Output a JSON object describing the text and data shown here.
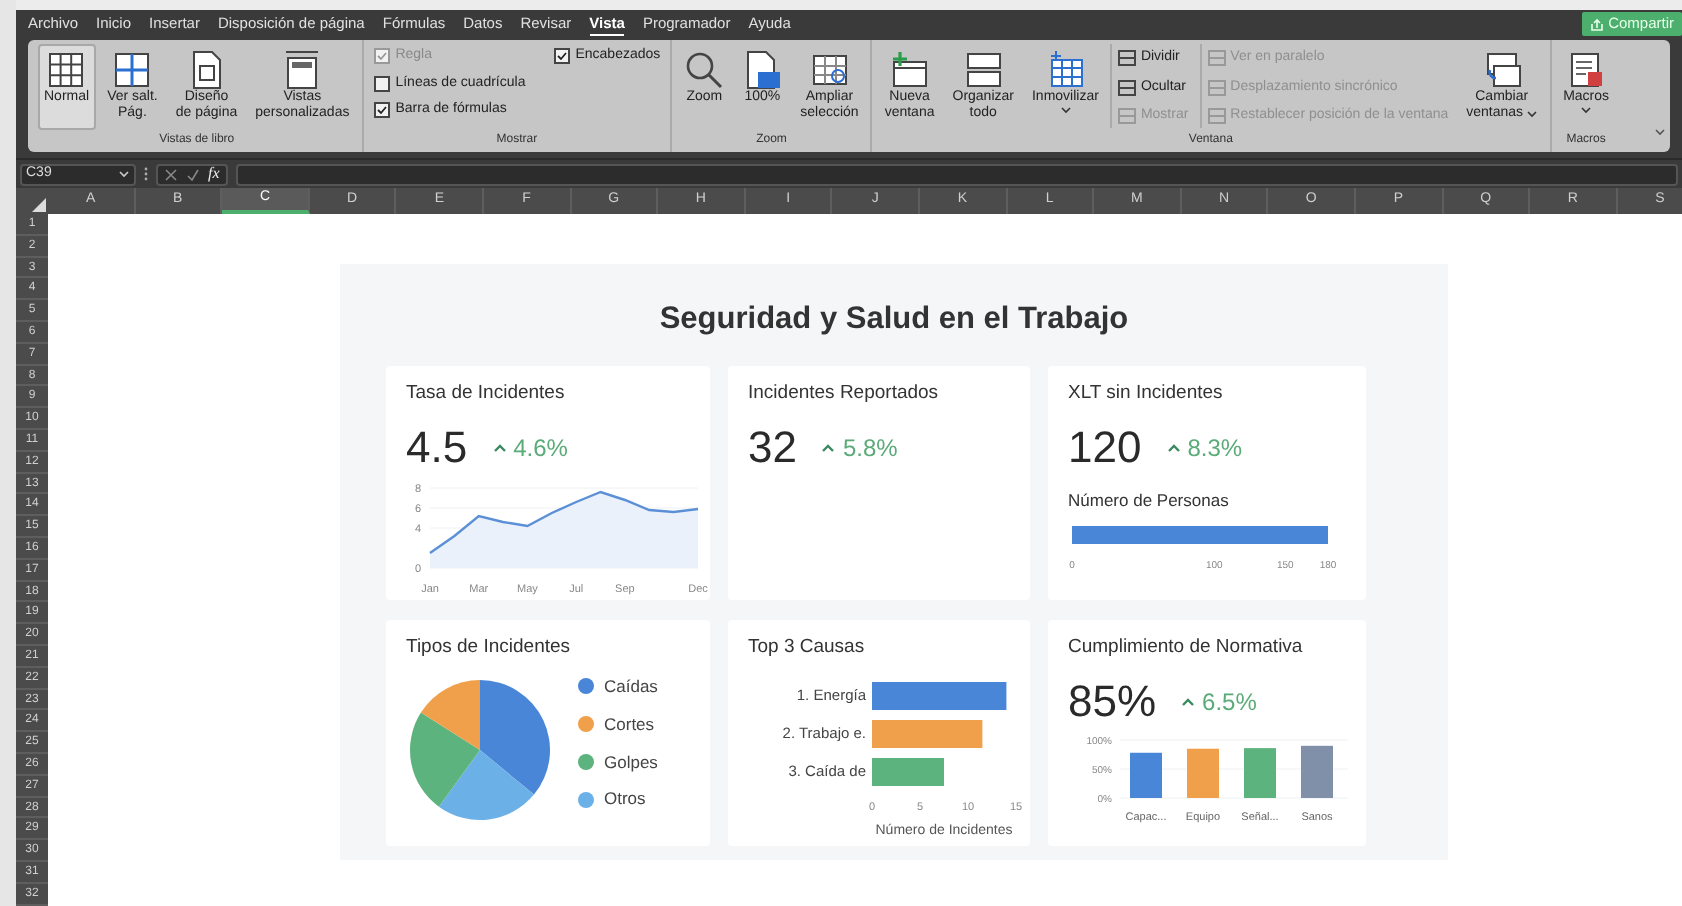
{
  "menu": [
    {
      "label": "Archivo",
      "selected": false
    },
    {
      "label": "Inicio",
      "selected": false
    },
    {
      "label": "Insertar",
      "selected": false
    },
    {
      "label": "Disposición de página",
      "selected": false
    },
    {
      "label": "Fórmulas",
      "selected": false
    },
    {
      "label": "Datos",
      "selected": false
    },
    {
      "label": "Revisar",
      "selected": false
    },
    {
      "label": "Vista",
      "selected": true
    },
    {
      "label": "Programador",
      "selected": false
    },
    {
      "label": "Ayuda",
      "selected": false
    }
  ],
  "share_button": "Compartir",
  "ribbon": [
    {
      "label": "Vistas de libro",
      "items": [
        {
          "kind": "large",
          "lines": [
            "Normal"
          ],
          "selected": true
        },
        {
          "kind": "large",
          "lines": [
            "Ver salt.",
            "Pág."
          ],
          "selected": false
        },
        {
          "kind": "large",
          "lines": [
            "Diseño",
            "de página"
          ],
          "selected": false
        },
        {
          "kind": "large",
          "lines": [
            "Vistas",
            "personalizadas"
          ],
          "selected": false
        }
      ]
    },
    {
      "label": "Mostrar",
      "items": [
        {
          "kind": "check",
          "label": "Regla",
          "checked": true,
          "disabled": true
        },
        {
          "kind": "check",
          "label": "Líneas de cuadrícula",
          "checked": false,
          "disabled": false
        },
        {
          "kind": "check",
          "label": "Barra de fórmulas",
          "checked": true,
          "disabled": false
        },
        {
          "kind": "check",
          "label": "Encabezados",
          "checked": true,
          "disabled": false
        }
      ]
    },
    {
      "label": "Zoom",
      "items": [
        {
          "kind": "large",
          "lines": [
            "Zoom"
          ]
        },
        {
          "kind": "large",
          "lines": [
            "100%"
          ]
        },
        {
          "kind": "large",
          "lines": [
            "Ampliar",
            "selección"
          ]
        }
      ]
    },
    {
      "label": "Ventana",
      "items": [
        {
          "kind": "large",
          "lines": [
            "Nueva",
            "ventana"
          ]
        },
        {
          "kind": "large",
          "lines": [
            "Organizar",
            "todo"
          ]
        },
        {
          "kind": "large",
          "lines": [
            "Inmovilizar"
          ],
          "dropdown": true
        },
        {
          "kind": "small",
          "label": "Dividir",
          "disabled": false
        },
        {
          "kind": "small",
          "label": "Ocultar",
          "disabled": false
        },
        {
          "kind": "small",
          "label": "Mostrar",
          "disabled": true
        },
        {
          "kind": "small",
          "label": "Ver en paralelo",
          "disabled": true
        },
        {
          "kind": "small",
          "label": "Desplazamiento sincrónico",
          "disabled": true
        },
        {
          "kind": "small",
          "label": "Restablecer posición de la ventana",
          "disabled": true
        },
        {
          "kind": "large",
          "lines": [
            "Cambiar",
            "ventanas"
          ],
          "dropdown": true
        }
      ]
    },
    {
      "label": "Macros",
      "items": [
        {
          "kind": "large",
          "lines": [
            "Macros"
          ],
          "dropdown": true
        }
      ]
    }
  ],
  "formula_bar": {
    "cell": "C39",
    "fx": "fx"
  },
  "columns": [
    {
      "label": "A",
      "selected": false
    },
    {
      "label": "B",
      "selected": false
    },
    {
      "label": "C",
      "selected": true
    },
    {
      "label": "D",
      "selected": false
    },
    {
      "label": "E",
      "selected": false
    },
    {
      "label": "F",
      "selected": false
    },
    {
      "label": "G",
      "selected": false
    },
    {
      "label": "H",
      "selected": false
    },
    {
      "label": "I",
      "selected": false
    },
    {
      "label": "J",
      "selected": false
    },
    {
      "label": "K",
      "selected": false
    },
    {
      "label": "L",
      "selected": false
    },
    {
      "label": "M",
      "selected": false
    },
    {
      "label": "N",
      "selected": false
    },
    {
      "label": "O",
      "selected": false
    },
    {
      "label": "P",
      "selected": false
    },
    {
      "label": "Q",
      "selected": false
    },
    {
      "label": "R",
      "selected": false
    },
    {
      "label": "S",
      "selected": false
    }
  ],
  "rows": [
    "1",
    "2",
    "3",
    "4",
    "5",
    "6",
    "7",
    "8",
    "9",
    "10",
    "11",
    "12",
    "13",
    "14",
    "15",
    "16",
    "17",
    "18",
    "19",
    "20",
    "21",
    "22",
    "23",
    "24",
    "25",
    "26",
    "27",
    "28",
    "29",
    "30",
    "31",
    "32"
  ],
  "dashboard": {
    "title": "Seguridad y Salud en el Trabajo",
    "cards": [
      {
        "kind": "kpi_line",
        "title": "Tasa de Incidentes",
        "value": "4.5",
        "change": "4.6%",
        "chart_data": {
          "type": "area",
          "categories": [
            "Jan",
            null,
            "Mar",
            null,
            "May",
            null,
            "Jul",
            null,
            "Sep",
            null,
            null,
            "Dec"
          ],
          "series": [
            {
              "color": "#5b8fd6",
              "values": [
                1.5,
                3.2,
                5.2,
                4.6,
                4.2,
                5.5,
                6.6,
                7.6,
                6.8,
                5.8,
                5.6,
                5.9
              ]
            }
          ],
          "ylim": [
            0,
            8
          ],
          "yticks": [
            0,
            4,
            6,
            8
          ]
        }
      },
      {
        "kind": "kpi",
        "title": "Incidentes Reportados",
        "value": "32",
        "change": "5.8%"
      },
      {
        "kind": "kpi_bar",
        "title": "XLT sin Incidentes",
        "value": "120",
        "change": "8.3%",
        "people_bar": {
          "title": "Número de Personas",
          "ticks": [
            "0",
            "100",
            "150",
            "180"
          ]
        }
      },
      {
        "kind": "chart",
        "title": "Tipos de Incidentes",
        "chart_data": {
          "type": "pie",
          "categories": [
            "Caídas",
            "Cortes",
            "Golpes",
            "Otros"
          ],
          "series": [
            {
              "values": [
                36,
                16,
                24,
                24
              ],
              "colors": [
                "#4a86d8",
                "#f0a04b",
                "#5db37e",
                "#6cb0e8"
              ]
            }
          ]
        }
      },
      {
        "kind": "chart",
        "title": "Top 3 Causas",
        "chart_data": {
          "type": "bar",
          "orientation": "horizontal",
          "categories": [
            "1. Energía",
            "2. Trabajo e.",
            "3. Caída de"
          ],
          "series": [
            {
              "values": [
                14,
                11.5,
                7.5
              ],
              "colors": [
                "#4a86d8",
                "#f0a04b",
                "#5db37e"
              ]
            }
          ],
          "xlim": [
            0,
            15
          ],
          "xticks": [
            0,
            5,
            10,
            15
          ],
          "xlabel": "Número de Incidentes"
        }
      },
      {
        "kind": "kpi_columns",
        "title": "Cumplimiento de Normativa",
        "value": "85%",
        "change": "6.5%",
        "chart_data": {
          "type": "bar",
          "categories": [
            "Capac...",
            "Equipo",
            "Señal...",
            "Sanos"
          ],
          "series": [
            {
              "values": [
                78,
                85,
                86,
                90
              ],
              "colors": [
                "#4a86d8",
                "#f0a04b",
                "#5db37e",
                "#8090a8"
              ]
            }
          ],
          "ylim": [
            0,
            100
          ],
          "yticks": [
            {
              "value": 0,
              "label": "0%"
            },
            {
              "value": 50,
              "label": "50%"
            },
            {
              "value": 100,
              "label": "100%"
            }
          ]
        }
      }
    ]
  }
}
